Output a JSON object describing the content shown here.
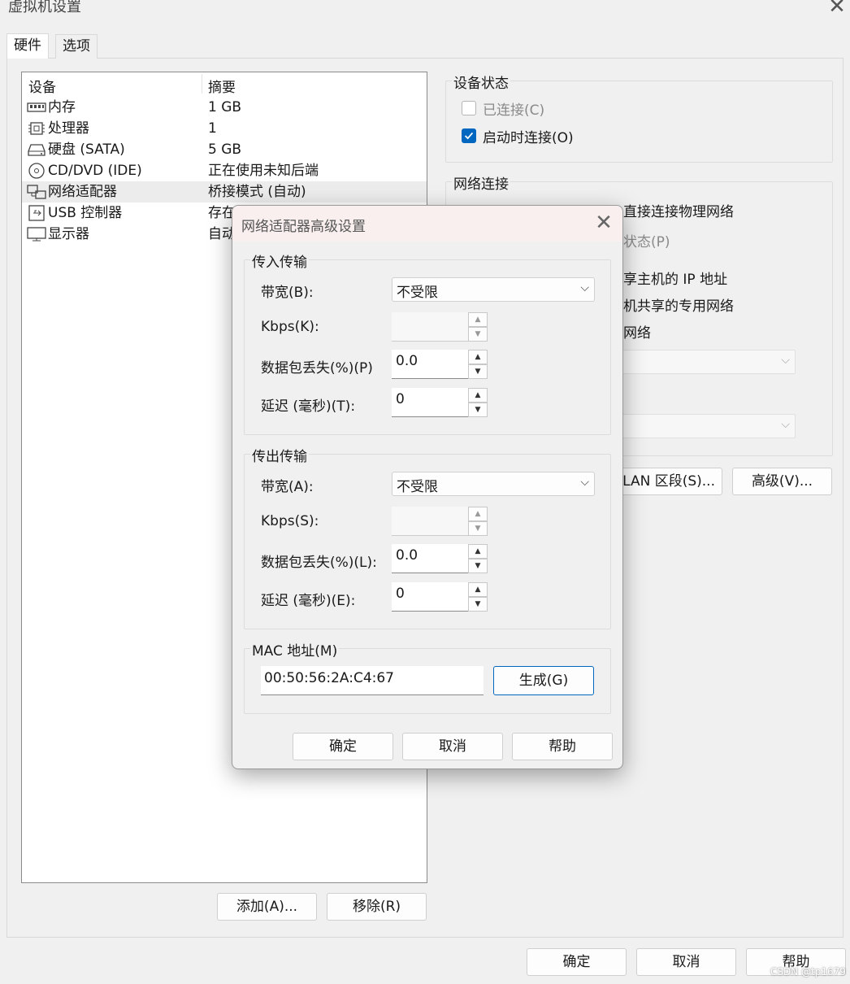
{
  "window": {
    "title": "虚拟机设置"
  },
  "tabs": [
    {
      "label": "硬件"
    },
    {
      "label": "选项"
    }
  ],
  "device_list": {
    "headers": {
      "device": "设备",
      "summary": "摘要"
    },
    "rows": [
      {
        "name": "内存",
        "summary": "1 GB",
        "icon": "memory-icon"
      },
      {
        "name": "处理器",
        "summary": "1",
        "icon": "cpu-icon"
      },
      {
        "name": "硬盘 (SATA)",
        "summary": "5 GB",
        "icon": "harddisk-icon"
      },
      {
        "name": "CD/DVD (IDE)",
        "summary": "正在使用未知后端",
        "icon": "cd-dvd-icon"
      },
      {
        "name": "网络适配器",
        "summary": "桥接模式 (自动)",
        "icon": "network-adapter-icon"
      },
      {
        "name": "USB 控制器",
        "summary": "存在",
        "icon": "usb-icon"
      },
      {
        "name": "显示器",
        "summary": "自动",
        "icon": "display-icon"
      }
    ],
    "selected_index": 4,
    "add_button": "添加(A)...",
    "remove_button": "移除(R)"
  },
  "device_status": {
    "title": "设备状态",
    "connected": {
      "label": "已连接(C)",
      "checked": false
    },
    "connect_at_power_on": {
      "label": "启动时连接(O)",
      "checked": true
    }
  },
  "network_connection": {
    "title": "网络连接",
    "bridged_partial": "直接连接物理网络",
    "replicate_partial": "状态(P)",
    "nat_partial": "享主机的 IP 地址",
    "hostonly_partial": "机共享的专用网络",
    "custom_partial": "网络",
    "lan_segments_partial": "LAN 区段(S)...",
    "advanced_button": "高级(V)..."
  },
  "dialog": {
    "title": "网络适配器高级设置",
    "incoming": {
      "title": "传入传输",
      "bandwidth_label": "带宽(B):",
      "bandwidth_value": "不受限",
      "kbps_label": "Kbps(K):",
      "kbps_value": "",
      "packet_loss_label": "数据包丢失(%)(P)",
      "packet_loss_value": "0.0",
      "latency_label": "延迟 (毫秒)(T):",
      "latency_value": "0"
    },
    "outgoing": {
      "title": "传出传输",
      "bandwidth_label": "带宽(A):",
      "bandwidth_value": "不受限",
      "kbps_label": "Kbps(S):",
      "kbps_value": "",
      "packet_loss_label": "数据包丢失(%)(L):",
      "packet_loss_value": "0.0",
      "latency_label": "延迟 (毫秒)(E):",
      "latency_value": "0"
    },
    "mac": {
      "title": "MAC 地址(M)",
      "value": "00:50:56:2A:C4:67",
      "generate_button": "生成(G)"
    },
    "ok_button": "确定",
    "cancel_button": "取消",
    "help_button": "帮助"
  },
  "footer": {
    "ok_button": "确定",
    "cancel_button": "取消",
    "help_button": "帮助"
  },
  "watermark": "CSDN @tp1679",
  "colors": {
    "accent": "#0067c0",
    "selected_row": "#ececec",
    "dialog_titlebar": "#f9efef"
  }
}
